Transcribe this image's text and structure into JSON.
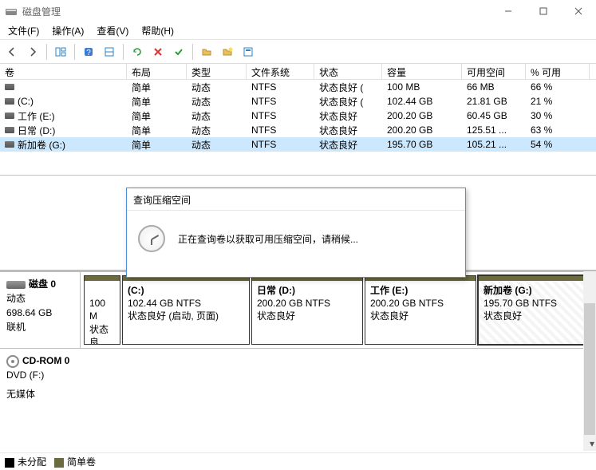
{
  "window": {
    "title": "磁盘管理"
  },
  "menus": [
    "文件(F)",
    "操作(A)",
    "查看(V)",
    "帮助(H)"
  ],
  "columns": [
    "卷",
    "布局",
    "类型",
    "文件系统",
    "状态",
    "容量",
    "可用空间",
    "% 可用"
  ],
  "rows": [
    {
      "vol": "",
      "layout": "简单",
      "type": "动态",
      "fs": "NTFS",
      "status": "状态良好 (",
      "cap": "100 MB",
      "free": "66 MB",
      "pct": "66 %"
    },
    {
      "vol": " (C:)",
      "layout": "简单",
      "type": "动态",
      "fs": "NTFS",
      "status": "状态良好 (",
      "cap": "102.44 GB",
      "free": "21.81 GB",
      "pct": "21 %"
    },
    {
      "vol": "工作 (E:)",
      "layout": "简单",
      "type": "动态",
      "fs": "NTFS",
      "status": "状态良好",
      "cap": "200.20 GB",
      "free": "60.45 GB",
      "pct": "30 %"
    },
    {
      "vol": "日常 (D:)",
      "layout": "简单",
      "type": "动态",
      "fs": "NTFS",
      "status": "状态良好",
      "cap": "200.20 GB",
      "free": "125.51 ...",
      "pct": "63 %"
    },
    {
      "vol": "新加卷 (G:)",
      "layout": "简单",
      "type": "动态",
      "fs": "NTFS",
      "status": "状态良好",
      "cap": "195.70 GB",
      "free": "105.21 ...",
      "pct": "54 %",
      "selected": true
    }
  ],
  "disk0": {
    "header": {
      "name": "磁盘 0",
      "type": "动态",
      "size": "698.64 GB",
      "state": "联机"
    },
    "parts": [
      {
        "title": "",
        "line2": "100 M",
        "line3": "状态良"
      },
      {
        "title": "(C:)",
        "line2": "102.44 GB NTFS",
        "line3": "状态良好 (启动, 页面)"
      },
      {
        "title": "日常  (D:)",
        "line2": "200.20 GB NTFS",
        "line3": "状态良好"
      },
      {
        "title": "工作  (E:)",
        "line2": "200.20 GB NTFS",
        "line3": "状态良好"
      },
      {
        "title": "新加卷  (G:)",
        "line2": "195.70 GB NTFS",
        "line3": "状态良好",
        "selected": true
      }
    ]
  },
  "cdrom": {
    "name": "CD-ROM 0",
    "line2": "DVD (F:)",
    "line3": "无媒体"
  },
  "legend": {
    "a": "未分配",
    "b": "简单卷"
  },
  "dialog": {
    "title": "查询压缩空间",
    "message": "正在查询卷以获取可用压缩空间，请稍候..."
  }
}
